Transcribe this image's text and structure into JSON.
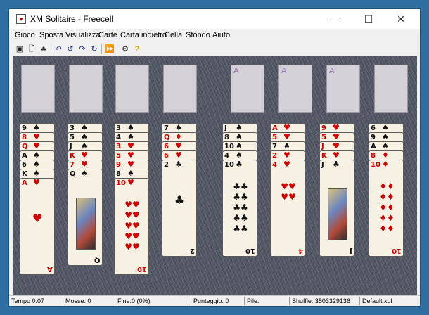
{
  "window": {
    "title": "XM Solitaire - Freecell",
    "app_icon": "solitaire-app-icon"
  },
  "menu": [
    "Gioco",
    "Sposta",
    "Visualizza",
    "Carte",
    "Carta indietro",
    "Cella",
    "Sfondo",
    "Aiuto"
  ],
  "toolbar": {
    "icons": [
      "new-game-icon",
      "open-icon",
      "deal-icon",
      "undo-icon",
      "undo-all-icon",
      "redo-icon",
      "redo-all-icon",
      "autoplay-icon",
      "options-icon",
      "help-icon"
    ]
  },
  "foundations": [
    "A",
    "A",
    "A"
  ],
  "columns": [
    {
      "cards": [
        {
          "rank": "9",
          "suit": "♠"
        },
        {
          "rank": "8",
          "suit": "♥"
        },
        {
          "rank": "Q",
          "suit": "♥"
        },
        {
          "rank": "A",
          "suit": "♠"
        },
        {
          "rank": "6",
          "suit": "♠"
        },
        {
          "rank": "K",
          "suit": "♠"
        },
        {
          "rank": "A",
          "suit": "♥"
        }
      ]
    },
    {
      "cards": [
        {
          "rank": "3",
          "suit": "♠"
        },
        {
          "rank": "5",
          "suit": "♠"
        },
        {
          "rank": "J",
          "suit": "♠"
        },
        {
          "rank": "K",
          "suit": "♥"
        },
        {
          "rank": "7",
          "suit": "♥"
        },
        {
          "rank": "Q",
          "suit": "♠"
        }
      ]
    },
    {
      "cards": [
        {
          "rank": "3",
          "suit": "♠"
        },
        {
          "rank": "4",
          "suit": "♠"
        },
        {
          "rank": "3",
          "suit": "♥"
        },
        {
          "rank": "5",
          "suit": "♥"
        },
        {
          "rank": "9",
          "suit": "♥"
        },
        {
          "rank": "8",
          "suit": "♠"
        },
        {
          "rank": "10",
          "suit": "♥"
        }
      ]
    },
    {
      "cards": [
        {
          "rank": "7",
          "suit": "♠"
        },
        {
          "rank": "Q",
          "suit": "♦"
        },
        {
          "rank": "6",
          "suit": "♥"
        },
        {
          "rank": "6",
          "suit": "♥"
        },
        {
          "rank": "2",
          "suit": "♣"
        }
      ]
    },
    {
      "cards": [
        {
          "rank": "J",
          "suit": "♠"
        },
        {
          "rank": "8",
          "suit": "♠"
        },
        {
          "rank": "10",
          "suit": "♠"
        },
        {
          "rank": "4",
          "suit": "♠"
        },
        {
          "rank": "10",
          "suit": "♣"
        }
      ]
    },
    {
      "cards": [
        {
          "rank": "A",
          "suit": "♥"
        },
        {
          "rank": "5",
          "suit": "♥"
        },
        {
          "rank": "7",
          "suit": "♠"
        },
        {
          "rank": "2",
          "suit": "♥"
        },
        {
          "rank": "4",
          "suit": "♥"
        }
      ]
    },
    {
      "cards": [
        {
          "rank": "9",
          "suit": "♥"
        },
        {
          "rank": "5",
          "suit": "♥"
        },
        {
          "rank": "J",
          "suit": "♥"
        },
        {
          "rank": "K",
          "suit": "♥"
        },
        {
          "rank": "J",
          "suit": "♣"
        }
      ]
    },
    {
      "cards": [
        {
          "rank": "6",
          "suit": "♠"
        },
        {
          "rank": "9",
          "suit": "♠"
        },
        {
          "rank": "A",
          "suit": "♠"
        },
        {
          "rank": "8",
          "suit": "♦"
        },
        {
          "rank": "10",
          "suit": "♦"
        }
      ]
    }
  ],
  "status": {
    "time": "Tempo 0:07",
    "moves": "Mosse: 0",
    "end": "Fine:0  (0%)",
    "score": "Punteggio: 0",
    "piles": "Pile:",
    "shuffle": "Shuffle: 3503329136",
    "layout": "Default.xol"
  }
}
